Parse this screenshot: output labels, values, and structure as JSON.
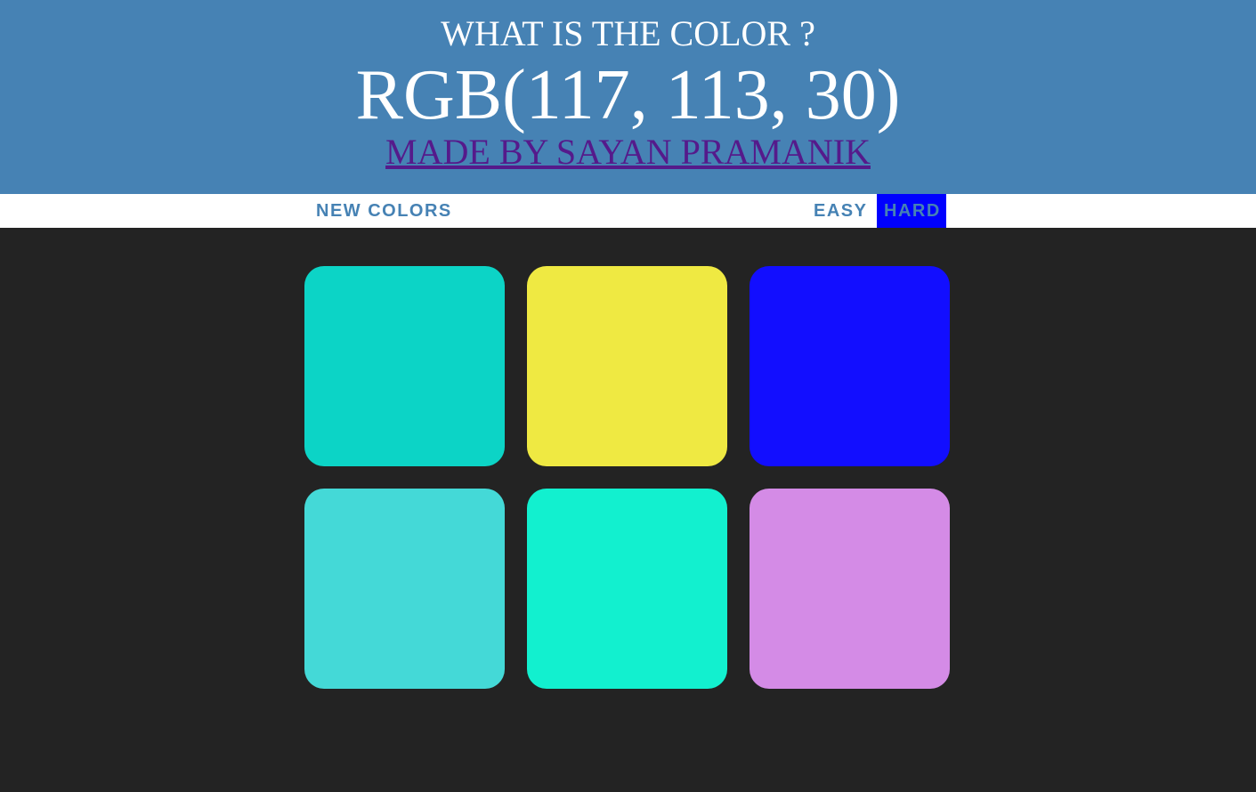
{
  "header": {
    "question": "WHAT IS THE COLOR ?",
    "target_rgb": "RGB(117, 113, 30)",
    "author_link": "MADE BY SAYAN PRAMANIK"
  },
  "controls": {
    "new_colors_label": "NEW COLORS",
    "easy_label": "EASY",
    "hard_label": "HARD",
    "selected_mode": "HARD"
  },
  "colors": {
    "header_bg": "#4682b4",
    "page_bg": "#232323",
    "accent_button_text": "#4682b4",
    "selected_mode_bg": "#0000ff"
  },
  "squares": [
    {
      "color": "#0cd4c6"
    },
    {
      "color": "#efe942"
    },
    {
      "color": "#120eff"
    },
    {
      "color": "#44d9d7"
    },
    {
      "color": "#12f0cf"
    },
    {
      "color": "#d48be6"
    }
  ]
}
